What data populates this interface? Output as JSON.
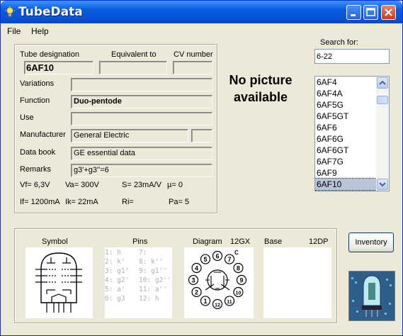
{
  "window": {
    "title": "TubeData"
  },
  "menu": {
    "file": "File",
    "help": "Help"
  },
  "headers": {
    "designation": "Tube designation",
    "equivalent": "Equivalent to",
    "cv": "CV number"
  },
  "tube": {
    "designation": "6AF10",
    "equivalent": "",
    "cv": "",
    "variations": "",
    "function": "Duo-pentode",
    "use": "",
    "manufacturer": "General Electric",
    "manufacturer_code": "",
    "data_book": "GE essential data",
    "remarks": "g3'+g3''=6"
  },
  "labels": {
    "variations": "Variations",
    "function": "Function",
    "use": "Use",
    "manufacturer": "Manufacturer",
    "data_book": "Data book",
    "remarks": "Remarks"
  },
  "specs": {
    "vf": "Vf= 6,3V",
    "va": "Va= 300V",
    "s": "S= 23mA/V",
    "mu": "µ= 0",
    "if": "If= 1200mA",
    "ik": "Ik= 22mA",
    "ri": "Ri=",
    "pa": "Pa= 5"
  },
  "picture": {
    "no_picture": "No picture available"
  },
  "search": {
    "label": "Search for:",
    "value": "6-22"
  },
  "tube_list": [
    "6AF4",
    "6AF4A",
    "6AF5G",
    "6AF5GT",
    "6AF6",
    "6AF6G",
    "6AF6GT",
    "6AF7G",
    "6AF9",
    "6AF10"
  ],
  "selected_tube": "6AF10",
  "bottom": {
    "symbol": "Symbol",
    "pins": "Pins",
    "diagram": "Diagram",
    "diagram_code": "12GX",
    "base": "Base",
    "base_code": "12DP",
    "pins_col1": "1: h\n2: k'\n3: g1'\n4: g2'\n5: a'\n6: g3",
    "pins_col2": "7:\n8: k''\n9: g1''\n10: g2''\n11: a''\n12: h",
    "diagram_pins": [
      "1",
      "2",
      "3",
      "4",
      "5",
      "6",
      "7",
      "8",
      "9",
      "10",
      "11",
      "12",
      "C"
    ]
  },
  "inventory_button": "Inventory",
  "colors": {
    "title_bar": "#0a5cdc",
    "list_selection": "#b8c4d8"
  }
}
